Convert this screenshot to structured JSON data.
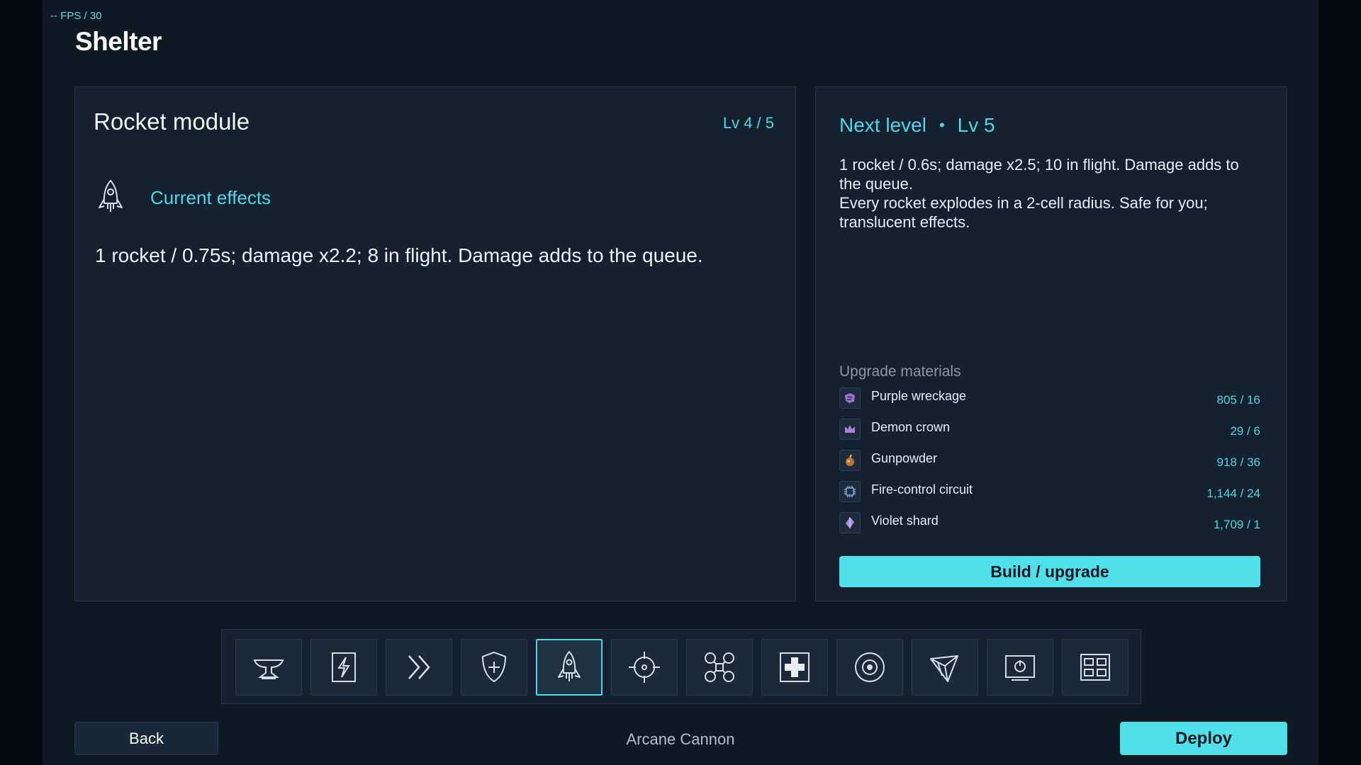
{
  "fps_label": "-- FPS / 30",
  "app_title": "Shelter",
  "module": {
    "title": "Rocket module",
    "level": "Lv 4 / 5",
    "current_label": "Current effects",
    "current_text": "1 rocket / 0.75s; damage x2.2; 8 in flight. Damage adds to the queue."
  },
  "next": {
    "label": "Next level",
    "separator": "•",
    "level": "Lv 5",
    "line1": "1 rocket / 0.6s; damage x2.5; 10 in flight. Damage adds to the queue.",
    "line2": "Every rocket explodes in a 2-cell radius. Safe for you; translucent effects."
  },
  "materials": {
    "heading": "Upgrade materials",
    "items": [
      {
        "name": "Purple wreckage",
        "count": "805 / 16",
        "icon": "purple-wreckage-icon",
        "color": "#9b6fd6"
      },
      {
        "name": "Demon crown",
        "count": "29 / 6",
        "icon": "demon-crown-icon",
        "color": "#b07fe0"
      },
      {
        "name": "Gunpowder",
        "count": "918 / 36",
        "icon": "gunpowder-icon",
        "color": "#e09040"
      },
      {
        "name": "Fire-control circuit",
        "count": "1,144 / 24",
        "icon": "circuit-icon",
        "color": "#7fa8d8"
      },
      {
        "name": "Violet shard",
        "count": "1,709 / 1",
        "icon": "violet-shard-icon",
        "color": "#a98ce8"
      }
    ]
  },
  "upgrade_button": "Build / upgrade",
  "toolbar_icons": [
    "anvil-icon",
    "lightning-icon",
    "double-chevron-icon",
    "shield-plus-icon",
    "rocket-icon",
    "crosshair-icon",
    "drone-icon",
    "medkit-icon",
    "target-icon",
    "prism-icon",
    "monitor-power-icon",
    "grid-modules-icon"
  ],
  "active_tool": "rocket-icon",
  "back_button": "Back",
  "footer_label": "Arcane Cannon",
  "deploy_button": "Deploy",
  "colors": {
    "accent": "#4fd7e6",
    "button": "#4fe0ea",
    "panel": "#132130",
    "background": "#0f1a25"
  }
}
